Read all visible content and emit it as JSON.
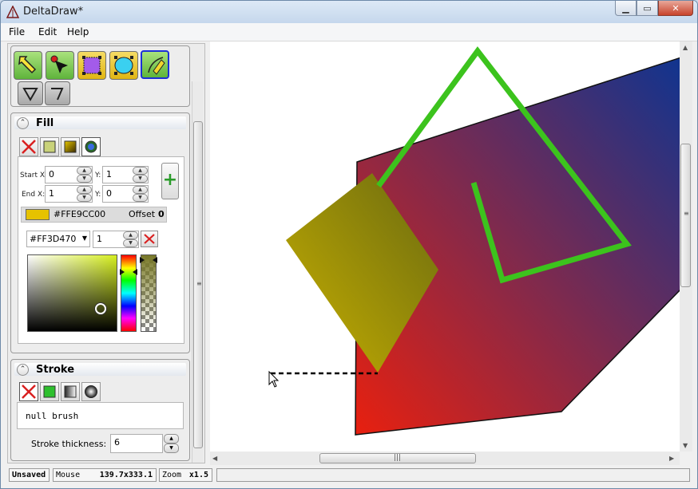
{
  "window": {
    "title": "DeltaDraw*"
  },
  "menu": {
    "file": "File",
    "edit": "Edit",
    "help": "Help"
  },
  "tools": [
    {
      "name": "select-arrow-tool-icon",
      "active": false
    },
    {
      "name": "node-edit-tool-icon",
      "active": false
    },
    {
      "name": "rectangle-tool-icon",
      "active": false
    },
    {
      "name": "ellipse-tool-icon",
      "active": false
    },
    {
      "name": "pen-tool-icon",
      "active": true
    }
  ],
  "fill": {
    "title": "Fill",
    "start_x_label": "Start X:",
    "start_x": "0",
    "start_y_label": "Y:",
    "start_y": "1",
    "end_x_label": "End X:",
    "end_x": "1",
    "end_y_label": "Y:",
    "end_y": "0",
    "stop_color_hex": "#FFE9CC00",
    "stop_color_swatch": "#e6c200",
    "offset_label": "Offset",
    "offset_value": "0",
    "color_input": "#FF3D470",
    "stop_offset_input": "1"
  },
  "stroke": {
    "title": "Stroke",
    "brush_text": "null brush",
    "thickness_label": "Stroke thickness:",
    "thickness_value": "6"
  },
  "status": {
    "save_state": "Unsaved",
    "mouse_label": "Mouse",
    "mouse_value": "139.7x333.1",
    "zoom_label": "Zoom",
    "zoom_value": "x1.5"
  },
  "colors": {
    "triangle_stroke": "#3cc31d",
    "polygon_gradient_start": "#e8200f",
    "polygon_gradient_end": "#10348f",
    "diamond_gradient_start": "#c8b000",
    "diamond_gradient_end": "#6a6a10",
    "accent_selected": "#1c2fd7"
  }
}
